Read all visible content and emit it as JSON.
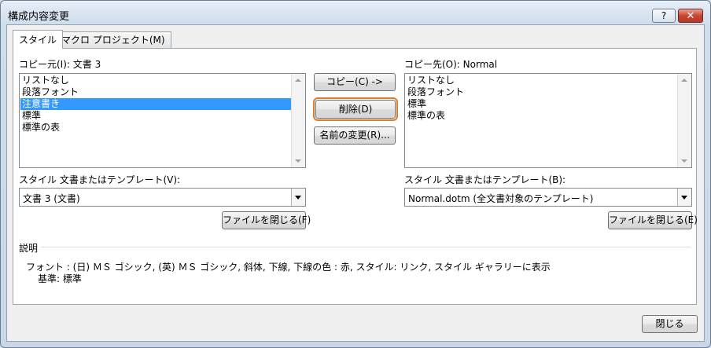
{
  "window": {
    "title": "構成内容変更",
    "help_label": "?",
    "close_label": "✕"
  },
  "tabs": [
    {
      "label": "スタイル"
    },
    {
      "label": "マクロ プロジェクト(M)"
    }
  ],
  "left": {
    "label": "コピー元(I): 文書 3",
    "items": [
      "リストなし",
      "段落フォント",
      "注意書き",
      "標準",
      "標準の表"
    ],
    "selected_index": 2,
    "combo_label": "スタイル 文書またはテンプレート(V):",
    "combo_value": "文書 3 (文書)",
    "close_file_label": "ファイルを閉じる(F)"
  },
  "right": {
    "label": "コピー先(O): Normal",
    "items": [
      "リストなし",
      "段落フォント",
      "標準",
      "標準の表"
    ],
    "combo_label": "スタイル 文書またはテンプレート(B):",
    "combo_value": "Normal.dotm (全文書対象のテンプレート)",
    "close_file_label": "ファイルを閉じる(E)"
  },
  "actions": {
    "copy_label": "コピー(C) ->",
    "delete_label": "削除(D)",
    "rename_label": "名前の変更(R)..."
  },
  "description": {
    "heading": "説明",
    "line1": "フォント : (日) ＭＳ ゴシック, (英) ＭＳ ゴシック, 斜体, 下線, 下線の色 : 赤, スタイル: リンク, スタイル ギャラリーに表示",
    "line2": "基準: 標準"
  },
  "footer": {
    "close_label": "閉じる"
  },
  "colors": {
    "selection": "#3399ff",
    "focus_outline": "#e07a2b",
    "close_button": "#c9452f"
  }
}
